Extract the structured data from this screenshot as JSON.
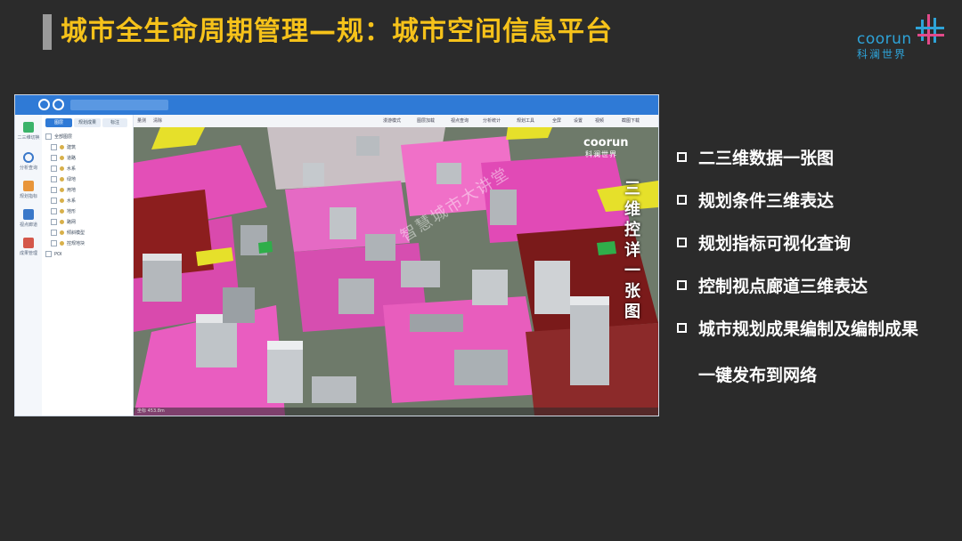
{
  "slide": {
    "title": "城市全生命周期管理—规：城市空间信息平台",
    "logo_text": "coorun",
    "logo_sub": "科澜世界",
    "accent_color": "#f6c21a"
  },
  "app": {
    "nav_items": [
      {
        "label": "二三维切换"
      },
      {
        "label": "分析查询"
      },
      {
        "label": "规划指标"
      },
      {
        "label": "视点廊道"
      },
      {
        "label": "成果管理"
      }
    ],
    "layer_tabs": [
      "图层",
      "规划成果",
      "标注"
    ],
    "layer_rows": [
      "全部图层",
      "建筑",
      "道路",
      "水系",
      "绿地",
      "用地",
      "水系",
      "地形",
      "路网",
      "倾斜模型",
      "控规地块",
      "POI"
    ],
    "toolbar_items": [
      "量测",
      "清除",
      "漫游模式",
      "图层加载",
      "视点查询",
      "分析统计",
      "规划工具",
      "全屏",
      "设置",
      "视频",
      "截图下载"
    ],
    "status_text": "坐标  453.8m",
    "viewer_logo": "coorun",
    "viewer_logo_sub": "科澜世界",
    "watermark": "智慧城市大讲堂",
    "vertical_label": [
      "三",
      "维",
      "控",
      "详",
      "一",
      "张",
      "图"
    ]
  },
  "bullets": [
    "二三维数据一张图",
    "规划条件三维表达",
    "规划指标可视化查询",
    "控制视点廊道三维表达",
    "城市规划成果编制及编制成果"
  ],
  "bullet_continuation": "一键发布到网络"
}
